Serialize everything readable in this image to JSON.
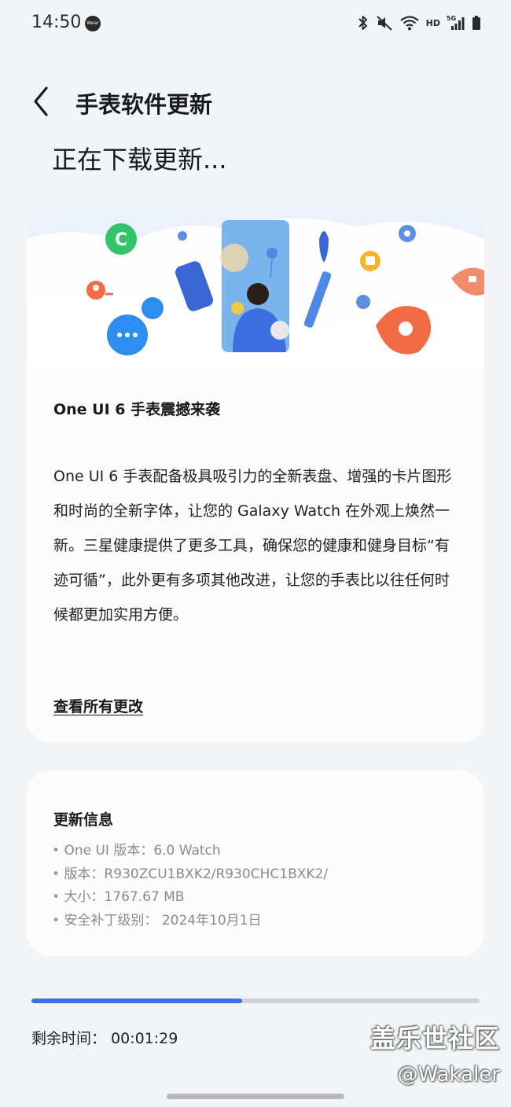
{
  "status_bar": {
    "time": "14:50",
    "app_icon_label": "Wear",
    "network_label": "HD",
    "signal_label": "5G",
    "icons": [
      "bluetooth-icon",
      "mute-icon",
      "wifi-icon",
      "hd-icon",
      "signal-5g-icon",
      "battery-icon"
    ]
  },
  "header": {
    "back_icon": "chevron-left-icon",
    "title": "手表软件更新"
  },
  "status_heading": "正在下载更新...",
  "feature": {
    "title": "One UI 6 手表震撼来袭",
    "description": "One UI 6 手表配备极具吸引力的全新表盘、增强的卡片图形和时尚的全新字体，让您的 Galaxy Watch 在外观上焕然一新。三星健康提供了更多工具，确保您的健康和健身目标“有迹可循”，此外更有多项其他改进，让您的手表比以往任何时候都更加实用方便。",
    "link": "查看所有更改"
  },
  "update_info": {
    "title": "更新信息",
    "items": [
      "One UI 版本：6.0 Watch",
      "版本：R930ZCU1BXK2/R930CHC1BXK2/",
      "大小：1767.67 MB",
      "安全补丁级别： 2024年10月1日"
    ]
  },
  "download": {
    "progress_fraction": 0.47,
    "remaining_label": "剩余时间：",
    "remaining_value": "00:01:29"
  },
  "watermark": {
    "line1": "盖乐世社区",
    "line2": "@Wakaler"
  },
  "colors": {
    "background": "#f3f4f6",
    "card": "#fcfcfd",
    "accent": "#3b74e0",
    "progress_track": "#cfd1d6",
    "secondary_text": "#8a8a8a"
  }
}
